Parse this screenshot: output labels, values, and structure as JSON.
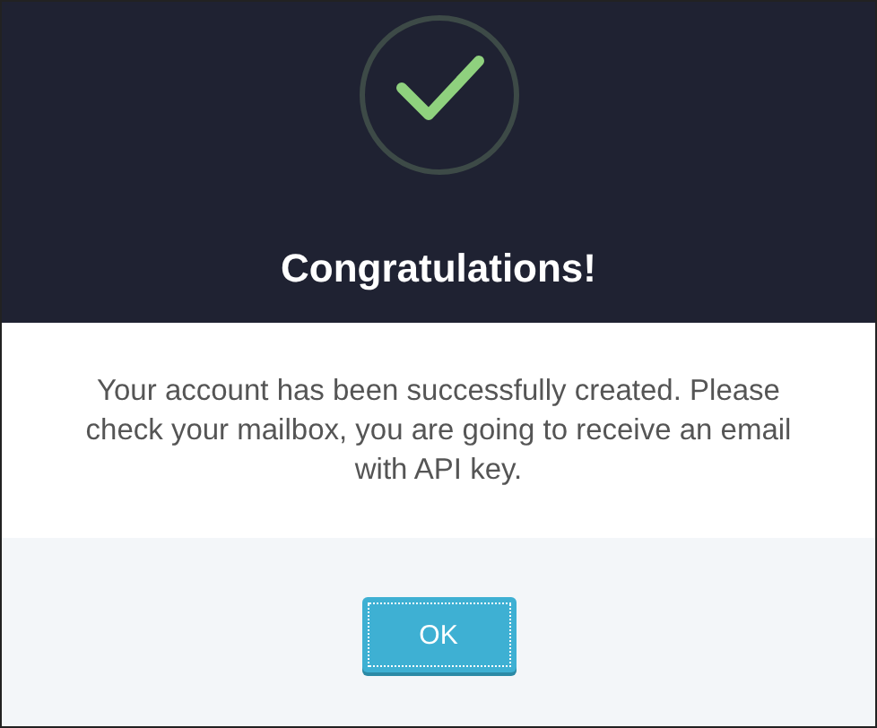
{
  "dialog": {
    "title": "Congratulations!",
    "message": "Your account has been successfully created. Please check your mailbox, you are going to receive an email with API key.",
    "buttons": [
      "OK"
    ]
  }
}
